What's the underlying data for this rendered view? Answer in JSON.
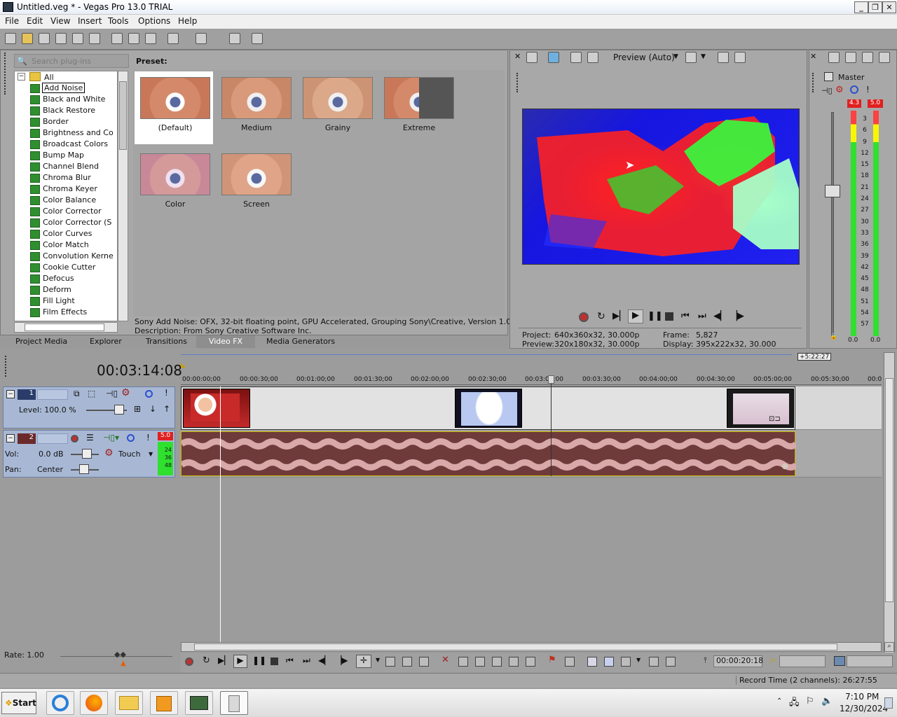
{
  "window": {
    "title": "Untitled.veg * - Vegas Pro 13.0 TRIAL",
    "controls": [
      "minimize-icon",
      "maximize-icon",
      "close-icon"
    ]
  },
  "menu": [
    "File",
    "Edit",
    "View",
    "Insert",
    "Tools",
    "Options",
    "Help"
  ],
  "explorer": {
    "search_placeholder": "Search plug-ins",
    "root": "All",
    "items": [
      "Add Noise",
      "Black and White",
      "Black Restore",
      "Border",
      "Brightness and Co",
      "Broadcast Colors",
      "Bump Map",
      "Channel Blend",
      "Chroma Blur",
      "Chroma Keyer",
      "Color Balance",
      "Color Corrector",
      "Color Corrector (S",
      "Color Curves",
      "Color Match",
      "Convolution Kerne",
      "Cookie Cutter",
      "Defocus",
      "Deform",
      "Fill Light",
      "Film Effects"
    ],
    "selected": "Add Noise"
  },
  "presets": {
    "heading": "Preset:",
    "items": [
      "(Default)",
      "Medium",
      "Grainy",
      "Extreme",
      "Color",
      "Screen"
    ],
    "description_line1": "Sony Add Noise: OFX, 32-bit floating point, GPU Accelerated, Grouping Sony\\Creative, Version 1.0",
    "description_line2": "Description: From Sony Creative Software Inc."
  },
  "tabs": [
    "Project Media",
    "Explorer",
    "Transitions",
    "Video FX",
    "Media Generators"
  ],
  "active_tab": "Video FX",
  "preview": {
    "mode": "Preview (Auto)",
    "project_label": "Project:",
    "project_value": "640x360x32, 30.000p",
    "preview_label": "Preview:",
    "preview_value": "320x180x32, 30.000p",
    "frame_label": "Frame:",
    "frame_value": "5,827",
    "display_label": "Display:",
    "display_value": "395x222x32, 30.000"
  },
  "master": {
    "title": "Master",
    "peak_left": "4.3",
    "peak_right": "5.0",
    "scale": [
      "3",
      "6",
      "9",
      "12",
      "15",
      "18",
      "21",
      "24",
      "27",
      "30",
      "33",
      "36",
      "39",
      "42",
      "45",
      "48",
      "51",
      "54",
      "57"
    ],
    "bottom_left": "0.0",
    "bottom_right": "0.0"
  },
  "timeline": {
    "timecode": "00:03:14:08",
    "end_marker": "+5:22:27",
    "ruler": [
      "00:00:00;00",
      "00:00:30;00",
      "00:01:00;00",
      "00:01:30;00",
      "00:02:00;00",
      "00:02:30;00",
      "00:03:00;00",
      "00:03:30;00",
      "00:04:00;00",
      "00:04:30;00",
      "00:05:00;00",
      "00:05:30;00",
      "00:0"
    ],
    "video_track": {
      "number": "1",
      "level": "Level: 100.0 %"
    },
    "audio_track": {
      "number": "2",
      "peak": "5.0",
      "vol_label": "Vol:",
      "vol_value": "0.0 dB",
      "pan_label": "Pan:",
      "pan_value": "Center",
      "mode": "Touch",
      "meter_scale": [
        "24",
        "36",
        "48"
      ]
    },
    "rate": "Rate: 1.00",
    "cursor_time": "00:00:20:18",
    "record_time": "Record Time (2 channels): 26:27:55"
  },
  "taskbar": {
    "start": "Start",
    "time": "7:10 PM",
    "date": "12/30/2024"
  }
}
